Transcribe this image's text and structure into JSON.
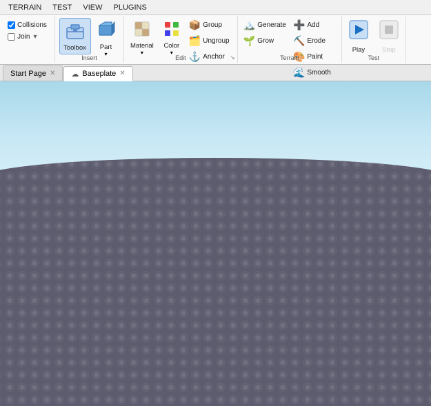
{
  "menu": {
    "items": [
      "TERRAIN",
      "TEST",
      "VIEW",
      "PLUGINS"
    ]
  },
  "ribbon": {
    "sections": {
      "model": {
        "label": "",
        "items": [
          {
            "id": "collisions",
            "label": "Collisions",
            "type": "checkbox",
            "checked": true
          },
          {
            "id": "join",
            "label": "Join",
            "type": "checkbox",
            "checked": false
          }
        ]
      },
      "insert": {
        "label": "Insert",
        "items": [
          {
            "id": "toolbox",
            "label": "Toolbox",
            "active": true
          },
          {
            "id": "part",
            "label": "Part"
          }
        ]
      },
      "edit": {
        "label": "Edit",
        "items": [
          {
            "id": "material",
            "label": "Material"
          },
          {
            "id": "color",
            "label": "Color"
          },
          {
            "id": "group",
            "label": "Group"
          },
          {
            "id": "ungroup",
            "label": "Ungroup"
          },
          {
            "id": "anchor",
            "label": "Anchor"
          }
        ]
      },
      "terrain": {
        "label": "Terrain",
        "items": [
          {
            "id": "generate",
            "label": "Generate"
          },
          {
            "id": "add",
            "label": "Add"
          },
          {
            "id": "erode",
            "label": "Erode"
          },
          {
            "id": "paint",
            "label": "Paint"
          },
          {
            "id": "grow",
            "label": "Grow"
          },
          {
            "id": "smooth",
            "label": "Smooth"
          }
        ]
      },
      "test": {
        "label": "Test",
        "items": [
          {
            "id": "play",
            "label": "Play"
          },
          {
            "id": "stop",
            "label": "Stop"
          }
        ]
      }
    }
  },
  "tabs": [
    {
      "id": "start-page",
      "label": "Start Page",
      "closeable": true,
      "active": false,
      "cloud": false
    },
    {
      "id": "baseplate",
      "label": "Baseplate",
      "closeable": true,
      "active": true,
      "cloud": true
    }
  ],
  "viewport": {
    "sky_color": "#a8d8ea",
    "terrain_color": "#5c5c6e"
  }
}
